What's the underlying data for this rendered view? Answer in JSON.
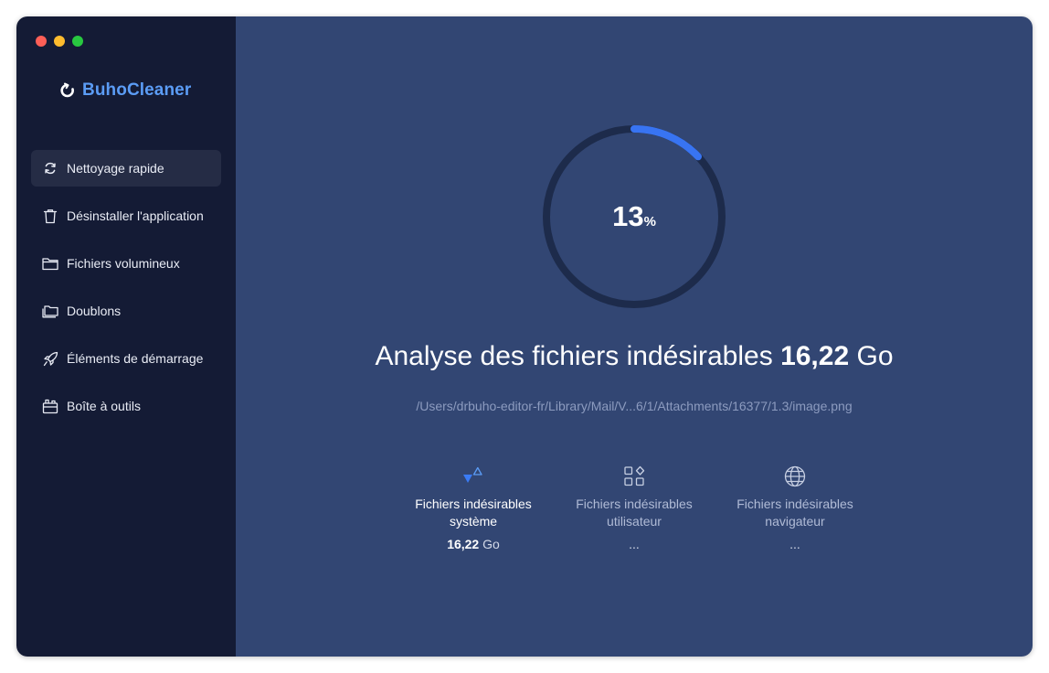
{
  "app": {
    "name": "BuhoCleaner",
    "brand_color": "#5b9cf5"
  },
  "sidebar": {
    "items": [
      {
        "label": "Nettoyage rapide",
        "icon": "refresh-icon",
        "active": true
      },
      {
        "label": "Désinstaller l'application",
        "icon": "trash-icon"
      },
      {
        "label": "Fichiers volumineux",
        "icon": "folder-icon"
      },
      {
        "label": "Doublons",
        "icon": "duplicate-folder-icon"
      },
      {
        "label": "Éléments de démarrage",
        "icon": "rocket-icon"
      },
      {
        "label": "Boîte à outils",
        "icon": "toolbox-icon"
      }
    ]
  },
  "scan": {
    "progress_percent": 13,
    "progress_number": "13",
    "progress_unit": "%",
    "progress_color": "#3874f2",
    "headline_prefix": "Analyse des fichiers indésirables",
    "headline_size": "16,22",
    "headline_unit": "Go",
    "current_path": "/Users/drbuho-editor-fr/Library/Mail/V...6/1/Attachments/16377/1.3/image.png"
  },
  "categories": [
    {
      "line1": "Fichiers indésirables",
      "line2": "système",
      "value_bold": "16,22",
      "value_unit": "Go",
      "icon": "system-junk-icon",
      "active": true
    },
    {
      "line1": "Fichiers indésirables",
      "line2": "utilisateur",
      "value": "...",
      "icon": "apps-grid-icon"
    },
    {
      "line1": "Fichiers indésirables",
      "line2": "navigateur",
      "value": "...",
      "icon": "globe-icon"
    }
  ]
}
